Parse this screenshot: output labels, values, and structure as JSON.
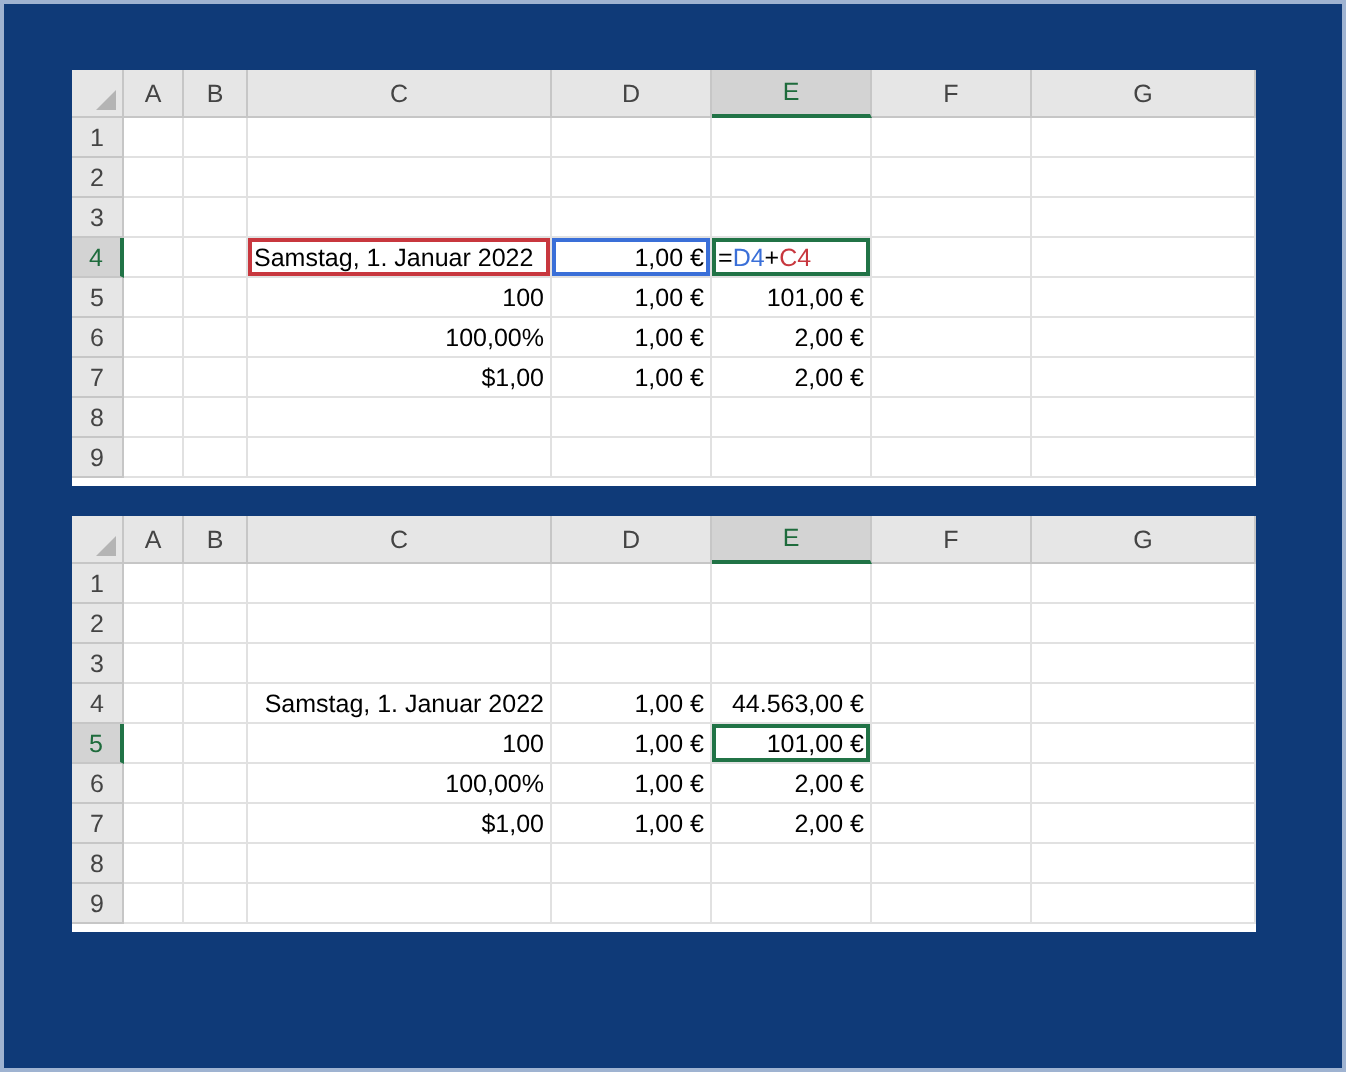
{
  "sheets": [
    {
      "columns": [
        {
          "label": "A",
          "selected": false
        },
        {
          "label": "B",
          "selected": false
        },
        {
          "label": "C",
          "selected": false
        },
        {
          "label": "D",
          "selected": false
        },
        {
          "label": "E",
          "selected": true
        },
        {
          "label": "F",
          "selected": false
        },
        {
          "label": "G",
          "selected": false
        }
      ],
      "rows": [
        {
          "number": "1",
          "selected": false
        },
        {
          "number": "2",
          "selected": false
        },
        {
          "number": "3",
          "selected": false
        },
        {
          "number": "4",
          "selected": true,
          "c": {
            "text": "Samstag, 1. Januar 2022",
            "left_aligned": true,
            "referenced": true,
            "color": "#c8373e"
          },
          "d": {
            "text": "1,00 €",
            "referenced": true,
            "color": "#3a6fd8"
          },
          "e": {
            "formula": [
              {
                "text": "=",
                "color": "#000000"
              },
              {
                "text": "D4",
                "color": "#3a6fd8"
              },
              {
                "text": "+",
                "color": "#000000"
              },
              {
                "text": "C4",
                "color": "#c8373e"
              }
            ],
            "active": true
          }
        },
        {
          "number": "5",
          "selected": false,
          "c": {
            "text": "100"
          },
          "d": {
            "text": "1,00 €"
          },
          "e": {
            "text": "101,00 €"
          }
        },
        {
          "number": "6",
          "selected": false,
          "c": {
            "text": "100,00%"
          },
          "d": {
            "text": "1,00 €"
          },
          "e": {
            "text": "2,00 €"
          }
        },
        {
          "number": "7",
          "selected": false,
          "c": {
            "text": "$1,00"
          },
          "d": {
            "text": "1,00 €"
          },
          "e": {
            "text": "2,00 €"
          }
        },
        {
          "number": "8",
          "selected": false
        },
        {
          "number": "9",
          "selected": false
        }
      ]
    },
    {
      "columns": [
        {
          "label": "A",
          "selected": false
        },
        {
          "label": "B",
          "selected": false
        },
        {
          "label": "C",
          "selected": false
        },
        {
          "label": "D",
          "selected": false
        },
        {
          "label": "E",
          "selected": true
        },
        {
          "label": "F",
          "selected": false
        },
        {
          "label": "G",
          "selected": false
        }
      ],
      "rows": [
        {
          "number": "1",
          "selected": false
        },
        {
          "number": "2",
          "selected": false
        },
        {
          "number": "3",
          "selected": false
        },
        {
          "number": "4",
          "selected": false,
          "c": {
            "text": "Samstag, 1. Januar 2022"
          },
          "d": {
            "text": "1,00 €"
          },
          "e": {
            "text": "44.563,00 €"
          }
        },
        {
          "number": "5",
          "selected": true,
          "c": {
            "text": "100"
          },
          "d": {
            "text": "1,00 €"
          },
          "e": {
            "text": "101,00 €",
            "active": true
          }
        },
        {
          "number": "6",
          "selected": false,
          "c": {
            "text": "100,00%"
          },
          "d": {
            "text": "1,00 €"
          },
          "e": {
            "text": "2,00 €"
          }
        },
        {
          "number": "7",
          "selected": false,
          "c": {
            "text": "$1,00"
          },
          "d": {
            "text": "1,00 €"
          },
          "e": {
            "text": "2,00 €"
          }
        },
        {
          "number": "8",
          "selected": false
        },
        {
          "number": "9",
          "selected": false
        }
      ]
    }
  ]
}
